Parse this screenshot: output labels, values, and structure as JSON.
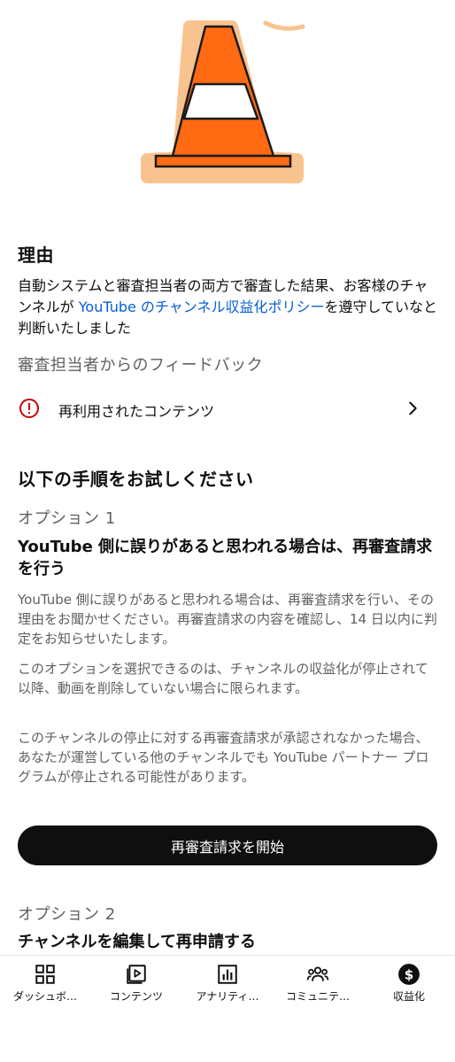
{
  "reason": {
    "heading": "理由",
    "text_before_link": "自動システムと審査担当者の両方で審査した結果、お客様のチャンネルが ",
    "link_text": "YouTube のチャンネル収益化ポリシー",
    "text_after_link": "を遵守していなと判断いたしました"
  },
  "feedback": {
    "heading": "審査担当者からのフィードバック",
    "item_label": "再利用されたコンテンツ",
    "item_icon": "alert-circle-icon",
    "chevron_icon": "chevron-right-icon",
    "alert_color": "#cc0000"
  },
  "steps": {
    "heading": "以下の手順をお試しください",
    "option1": {
      "label": "オプション 1",
      "title": "YouTube 側に誤りがあると思われる場合は、再審査請求を行う",
      "paragraph1": "YouTube 側に誤りがあると思われる場合は、再審査請求を行い、その理由をお聞かせください。再審査請求の内容を確認し、14 日以内に判定をお知らせいたします。",
      "paragraph2": "このオプションを選択できるのは、チャンネルの収益化が停止されて以降、動画を削除していない場合に限られます。",
      "paragraph3": "このチャンネルの停止に対する再審査請求が承認されなかった場合、あなたが運営している他のチャンネルでも YouTube パートナー プログラムが停止される可能性があります。",
      "button_label": "再審査請求を開始"
    },
    "option2": {
      "label": "オプション 2",
      "title": "チャンネルを編集して再申請する"
    }
  },
  "bottom_nav": [
    {
      "label": "ダッシュボ…",
      "icon": "dashboard-icon"
    },
    {
      "label": "コンテンツ",
      "icon": "content-icon"
    },
    {
      "label": "アナリティ…",
      "icon": "analytics-icon"
    },
    {
      "label": "コミュニテ…",
      "icon": "community-icon"
    },
    {
      "label": "収益化",
      "icon": "monetization-icon",
      "selected": true
    }
  ],
  "colors": {
    "link": "#065fd4",
    "cone_orange": "#ff6a13",
    "cone_outline_bg": "#f9c38f",
    "button_bg": "#0f0f0f"
  }
}
